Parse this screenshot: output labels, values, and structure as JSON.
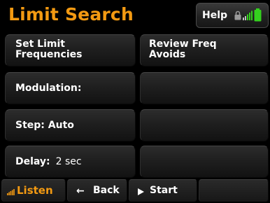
{
  "header": {
    "title": "Limit Search",
    "help_label": "Help",
    "icons": [
      "lock-icon",
      "signal-strength-icon",
      "battery-icon"
    ],
    "colors": {
      "title": "#f39a12",
      "battery": "#34d11e"
    }
  },
  "grid": {
    "set_limit_line1": "Set Limit",
    "set_limit_line2": "Frequencies",
    "review_line1": "Review Freq",
    "review_line2": "Avoids",
    "modulation": "Modulation:",
    "step": "Step: Auto",
    "delay_label": "Delay:",
    "delay_value": "2 sec"
  },
  "bottom_bar": {
    "listen": "Listen",
    "back_arrow": "←",
    "back": "Back",
    "start": "Start",
    "accent": "#f39a12"
  }
}
